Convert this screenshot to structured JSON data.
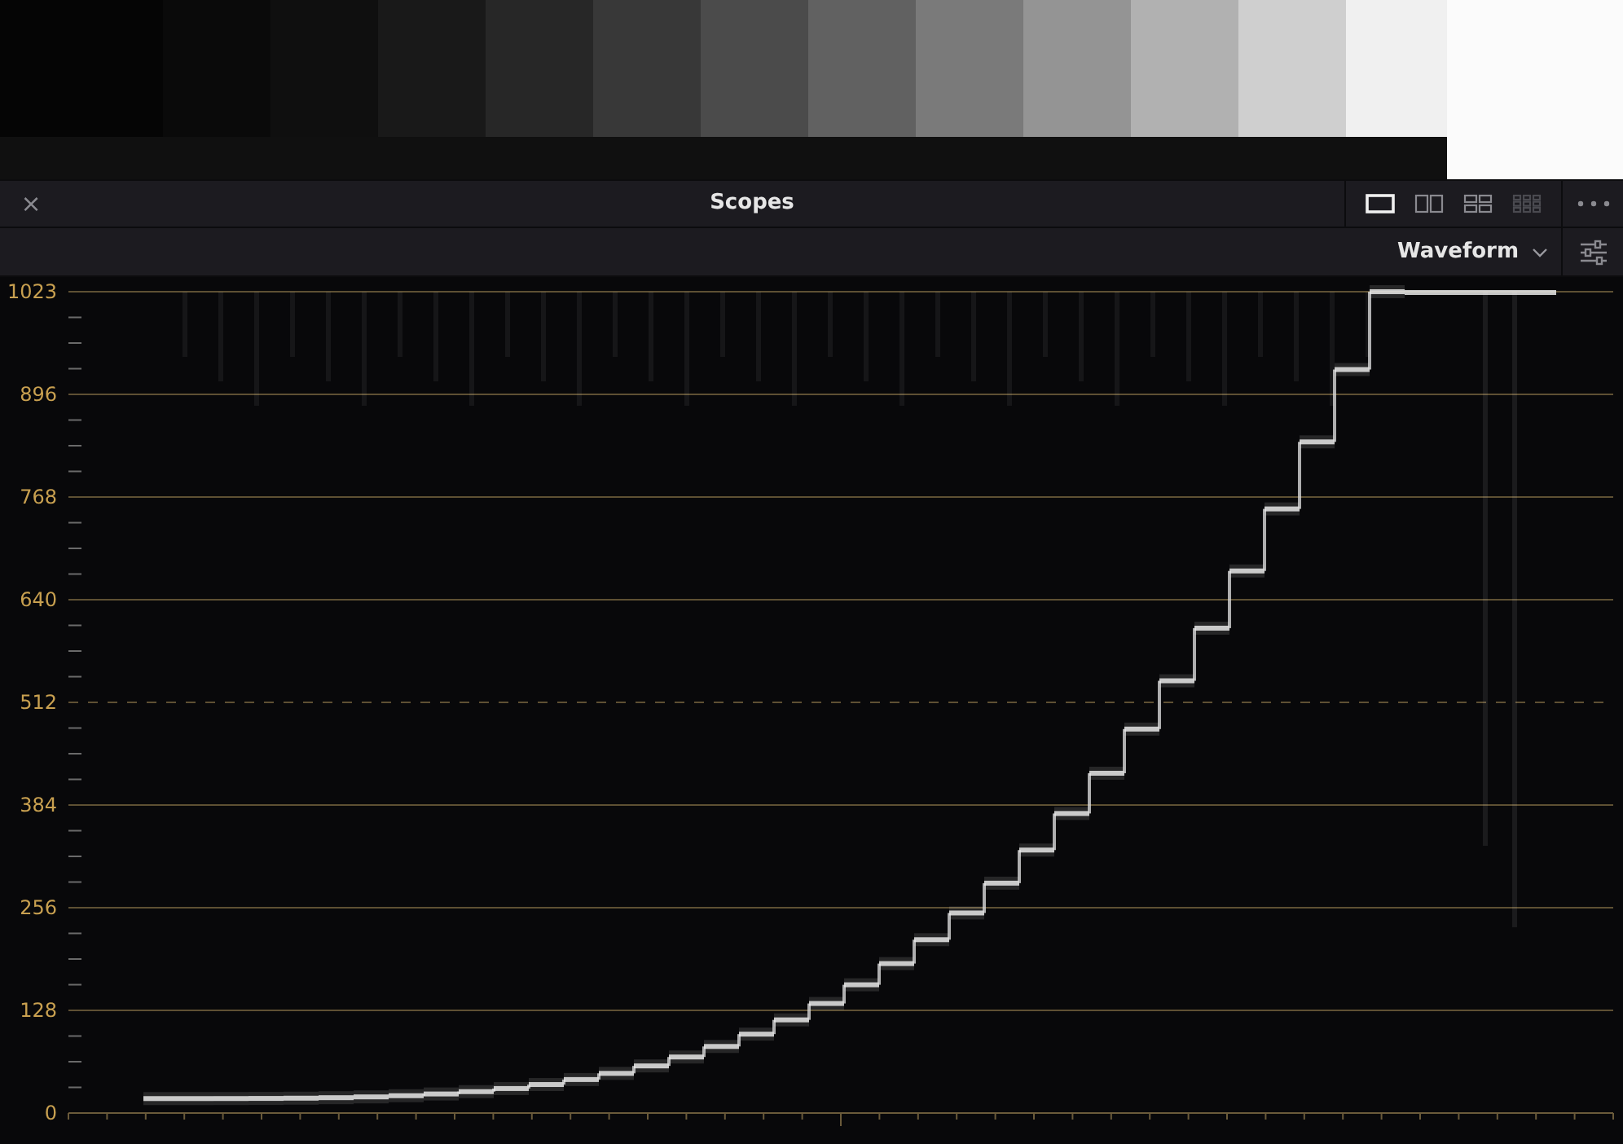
{
  "panel": {
    "close": "×",
    "title": "Scopes",
    "layouts": [
      {
        "kind": "single",
        "selected": true,
        "disabled": false
      },
      {
        "kind": "dual",
        "selected": false,
        "disabled": false
      },
      {
        "kind": "quad",
        "selected": false,
        "disabled": false
      },
      {
        "kind": "grid",
        "selected": false,
        "disabled": true
      }
    ]
  },
  "scope": {
    "type": "Waveform",
    "scale_labels": [
      "1023",
      "896",
      "768",
      "640",
      "512",
      "384",
      "256",
      "128",
      "0"
    ]
  }
}
